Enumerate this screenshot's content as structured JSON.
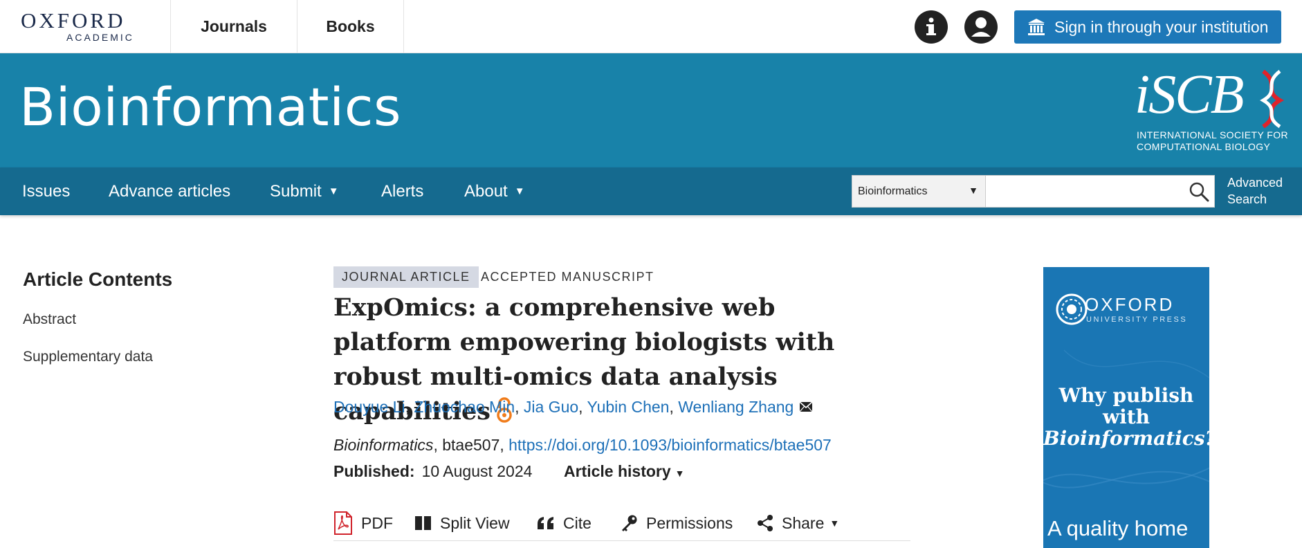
{
  "header": {
    "logo_top": "OXFORD",
    "logo_bottom": "ACADEMIC",
    "nav": [
      "Journals",
      "Books"
    ],
    "signin_label": "Sign in through your institution"
  },
  "banner": {
    "journal_title": "Bioinformatics",
    "society_logo": "iSCB",
    "society_name_line1": "INTERNATIONAL SOCIETY FOR",
    "society_name_line2": "COMPUTATIONAL BIOLOGY"
  },
  "navbar": {
    "items": [
      {
        "label": "Issues",
        "caret": ""
      },
      {
        "label": "Advance articles",
        "caret": ""
      },
      {
        "label": "Submit",
        "caret": "▼"
      },
      {
        "label": "Alerts",
        "caret": ""
      },
      {
        "label": "About",
        "caret": "▼"
      }
    ],
    "search_scope": "Bioinformatics",
    "search_value": "",
    "advanced_line1": "Advanced",
    "advanced_line2": "Search"
  },
  "sidebar": {
    "title": "Article Contents",
    "links": [
      "Abstract",
      "Supplementary data"
    ]
  },
  "article": {
    "type": "JOURNAL ARTICLE",
    "status": "ACCEPTED MANUSCRIPT",
    "title": "ExpOmics: a comprehensive web platform empowering biologists with robust multi-omics data analysis capabilities",
    "authors": [
      "Douyue Li",
      "Zhuochao Min",
      "Jia Guo",
      "Yubin Chen",
      "Wenliang Zhang"
    ],
    "journal": "Bioinformatics",
    "article_id": ", btae507, ",
    "doi": "https://doi.org/10.1093/bioinformatics/btae507",
    "published_label": "Published:",
    "published_date": "10 August 2024",
    "history_label": "Article history",
    "history_caret": "▼"
  },
  "toolbar": {
    "pdf": "PDF",
    "split_view": "Split View",
    "cite": "Cite",
    "permissions": "Permissions",
    "share": "Share",
    "share_caret": "▼"
  },
  "ad": {
    "brand": "OXFORD",
    "brand_sub": "UNIVERSITY PRESS",
    "line1": "Why publish with",
    "line2": "Bioinformatics?",
    "bottom": "A quality home"
  },
  "colors": {
    "banner": "#1882a9",
    "navbar": "#156a8f",
    "link": "#1d70b8",
    "signin": "#1d78b8",
    "open_access": "#f07c1b"
  }
}
